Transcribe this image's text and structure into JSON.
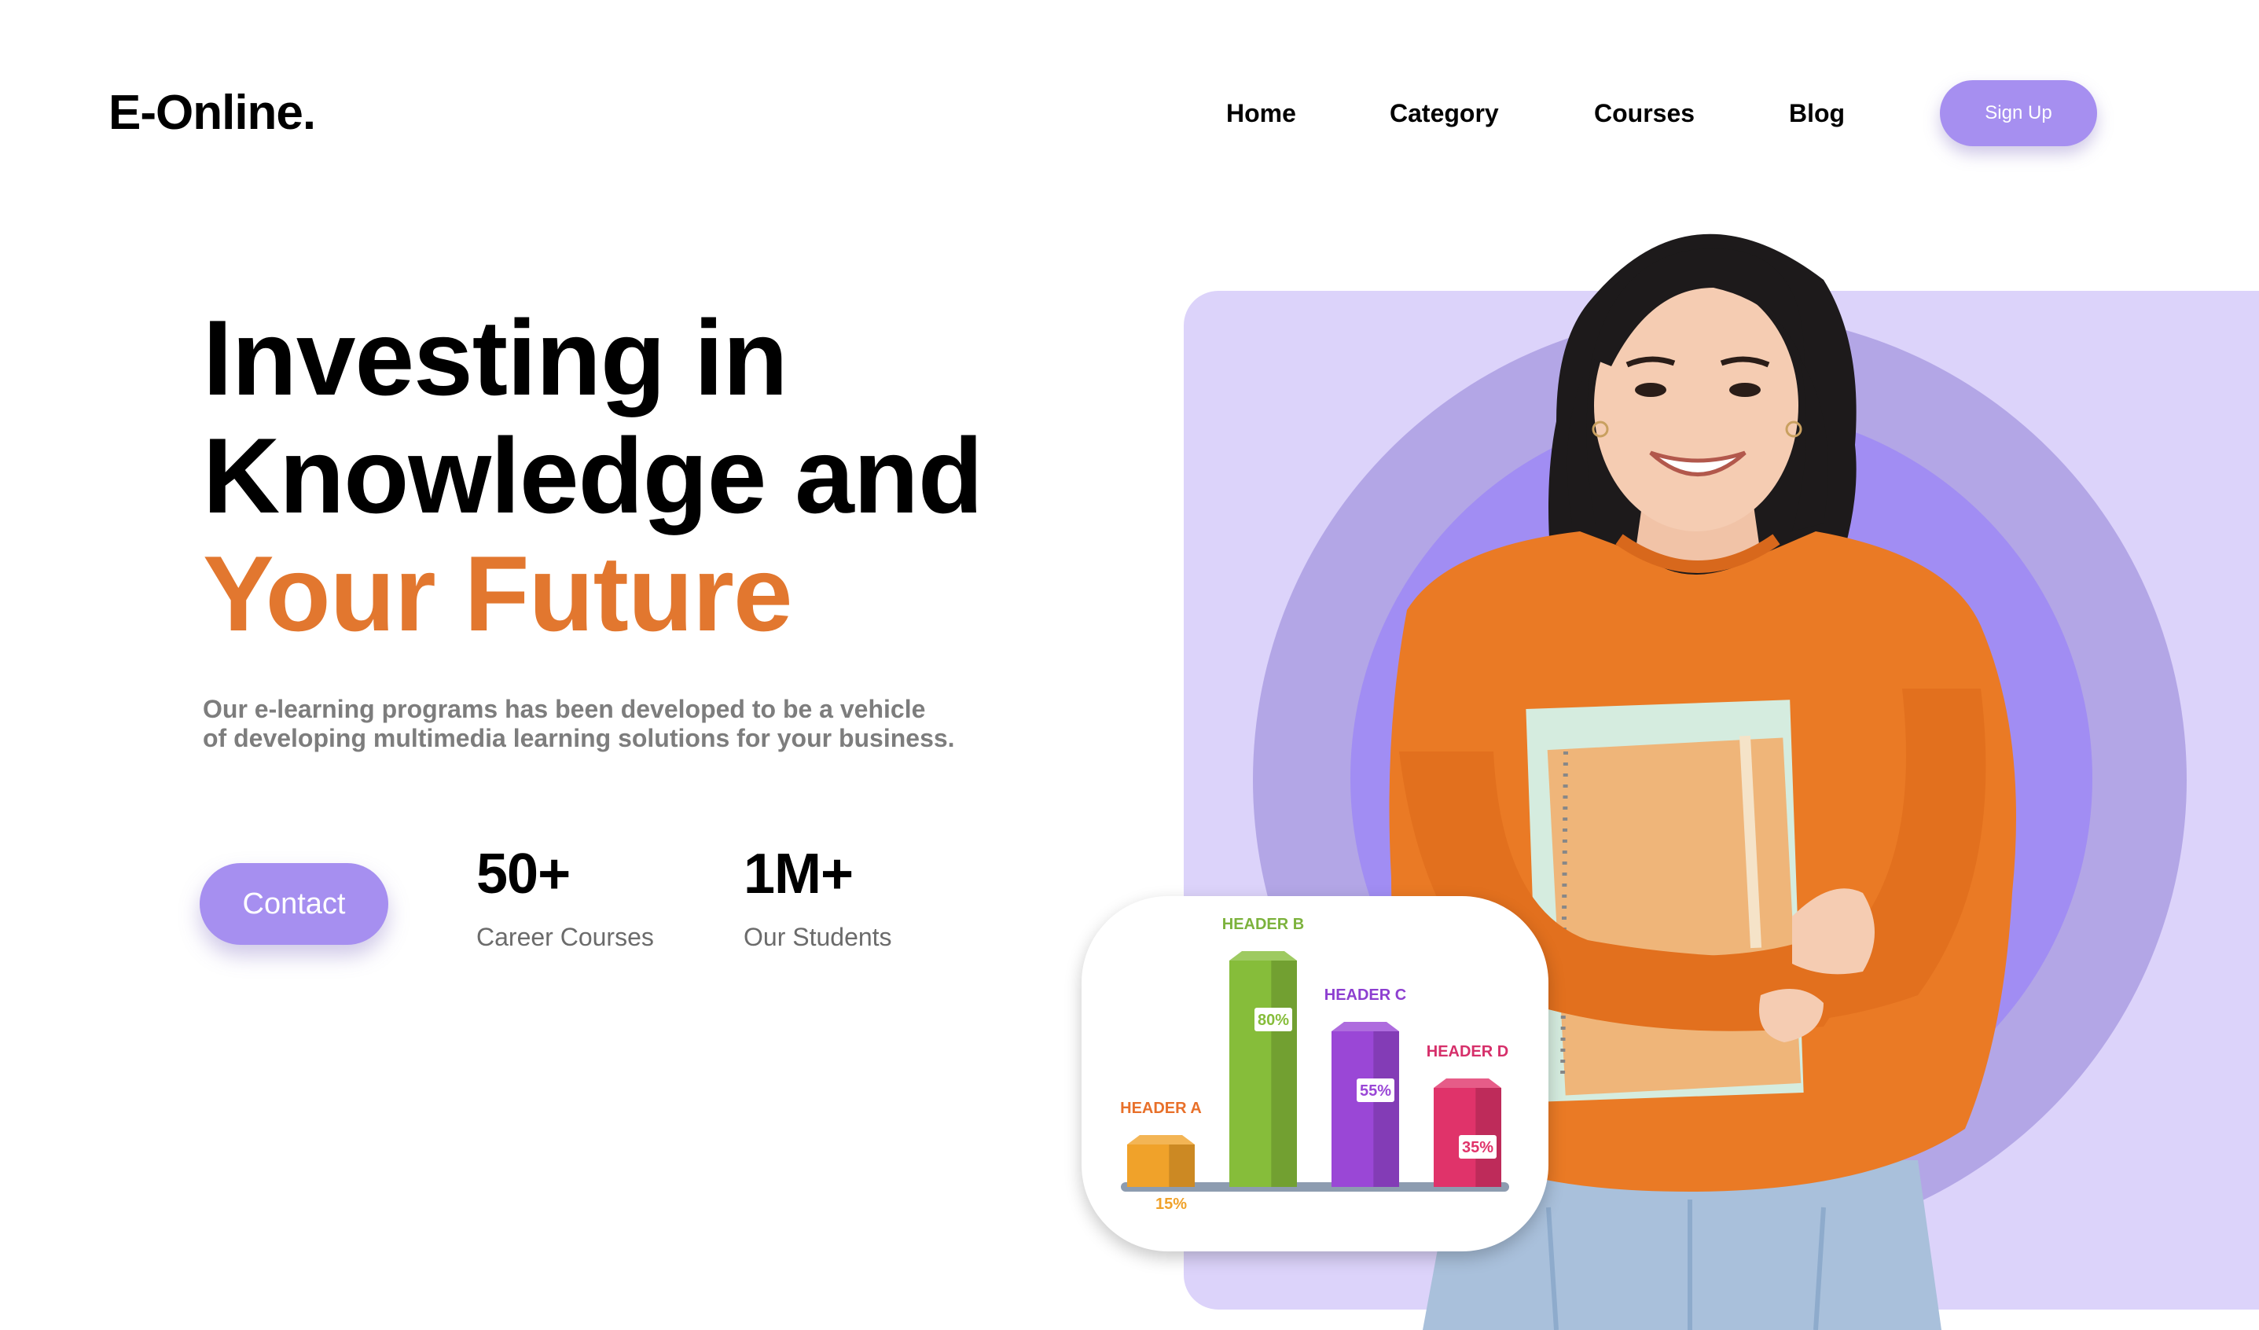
{
  "brand": {
    "logo": "E-Online."
  },
  "nav": {
    "items": [
      "Home",
      "Category",
      "Courses",
      "Blog"
    ],
    "signup_label": "Sign Up"
  },
  "hero": {
    "headline_line1": "Investing in",
    "headline_line2": "Knowledge and",
    "headline_line3": "Your Future",
    "subtitle_line1": "Our e-learning programs has been developed to be a vehicle",
    "subtitle_line2": "of developing multimedia learning solutions for your business.",
    "contact_label": "Contact"
  },
  "stats": [
    {
      "value": "50+",
      "label": "Career Courses"
    },
    {
      "value": "1M+",
      "label": "Our Students"
    }
  ],
  "colors": {
    "accent_purple": "#a68ff0",
    "accent_orange": "#e2772f",
    "panel_bg": "#dcd3fa",
    "ring_outer": "#b3a6e6",
    "ring_inner": "#a18df3"
  },
  "chart_data": {
    "type": "bar",
    "categories": [
      "HEADER A",
      "HEADER B",
      "HEADER C",
      "HEADER D"
    ],
    "values": [
      15,
      80,
      55,
      35
    ],
    "value_labels": [
      "15%",
      "80%",
      "55%",
      "35%"
    ],
    "colors": [
      "#f0a22a",
      "#86bd3a",
      "#9a47d6",
      "#e0336a"
    ],
    "label_colors": [
      "#e8702a",
      "#7cb23c",
      "#8d3fd0",
      "#d62f6a"
    ],
    "ylim": [
      0,
      100
    ]
  }
}
